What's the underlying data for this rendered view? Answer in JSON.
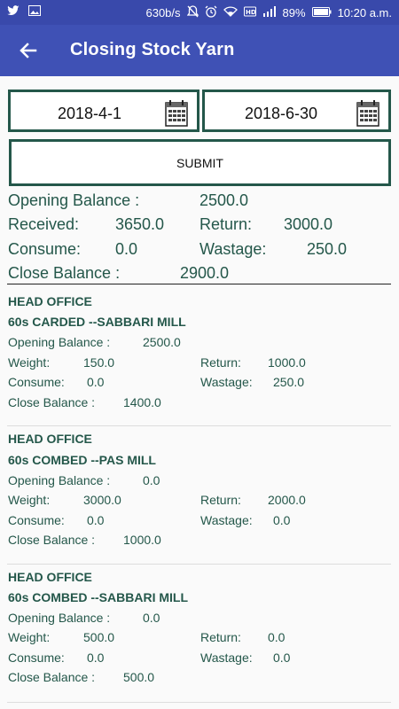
{
  "status": {
    "speed": "630b/s",
    "battery": "89%",
    "time": "10:20 a.m."
  },
  "appbar": {
    "title": "Closing Stock Yarn"
  },
  "filters": {
    "from_date": "2018-4-1",
    "to_date": "2018-6-30",
    "submit_label": "SUBMIT"
  },
  "summary": {
    "opening_label": "Opening Balance :",
    "opening_value": "2500.0",
    "received_label": "Received:",
    "received_value": "3650.0",
    "return_label": "Return:",
    "return_value": "3000.0",
    "consume_label": "Consume:",
    "consume_value": "0.0",
    "wastage_label": "Wastage:",
    "wastage_value": "250.0",
    "close_label": "Close Balance :",
    "close_value": "2900.0"
  },
  "labels": {
    "opening": "Opening Balance :",
    "weight": "Weight:",
    "return": "Return:",
    "consume": "Consume:",
    "wastage": "Wastage:",
    "close": "Close Balance :"
  },
  "items": [
    {
      "office": "HEAD OFFICE",
      "name": "60s CARDED --SABBARI MILL",
      "opening": "2500.0",
      "weight": "150.0",
      "return": "1000.0",
      "consume": "0.0",
      "wastage": "250.0",
      "close": "1400.0"
    },
    {
      "office": "HEAD OFFICE",
      "name": "60s COMBED --PAS  MILL",
      "opening": "0.0",
      "weight": "3000.0",
      "return": "2000.0",
      "consume": "0.0",
      "wastage": "0.0",
      "close": "1000.0"
    },
    {
      "office": "HEAD OFFICE",
      "name": "60s COMBED --SABBARI MILL",
      "opening": "0.0",
      "weight": "500.0",
      "return": "0.0",
      "consume": "0.0",
      "wastage": "0.0",
      "close": "500.0"
    }
  ]
}
